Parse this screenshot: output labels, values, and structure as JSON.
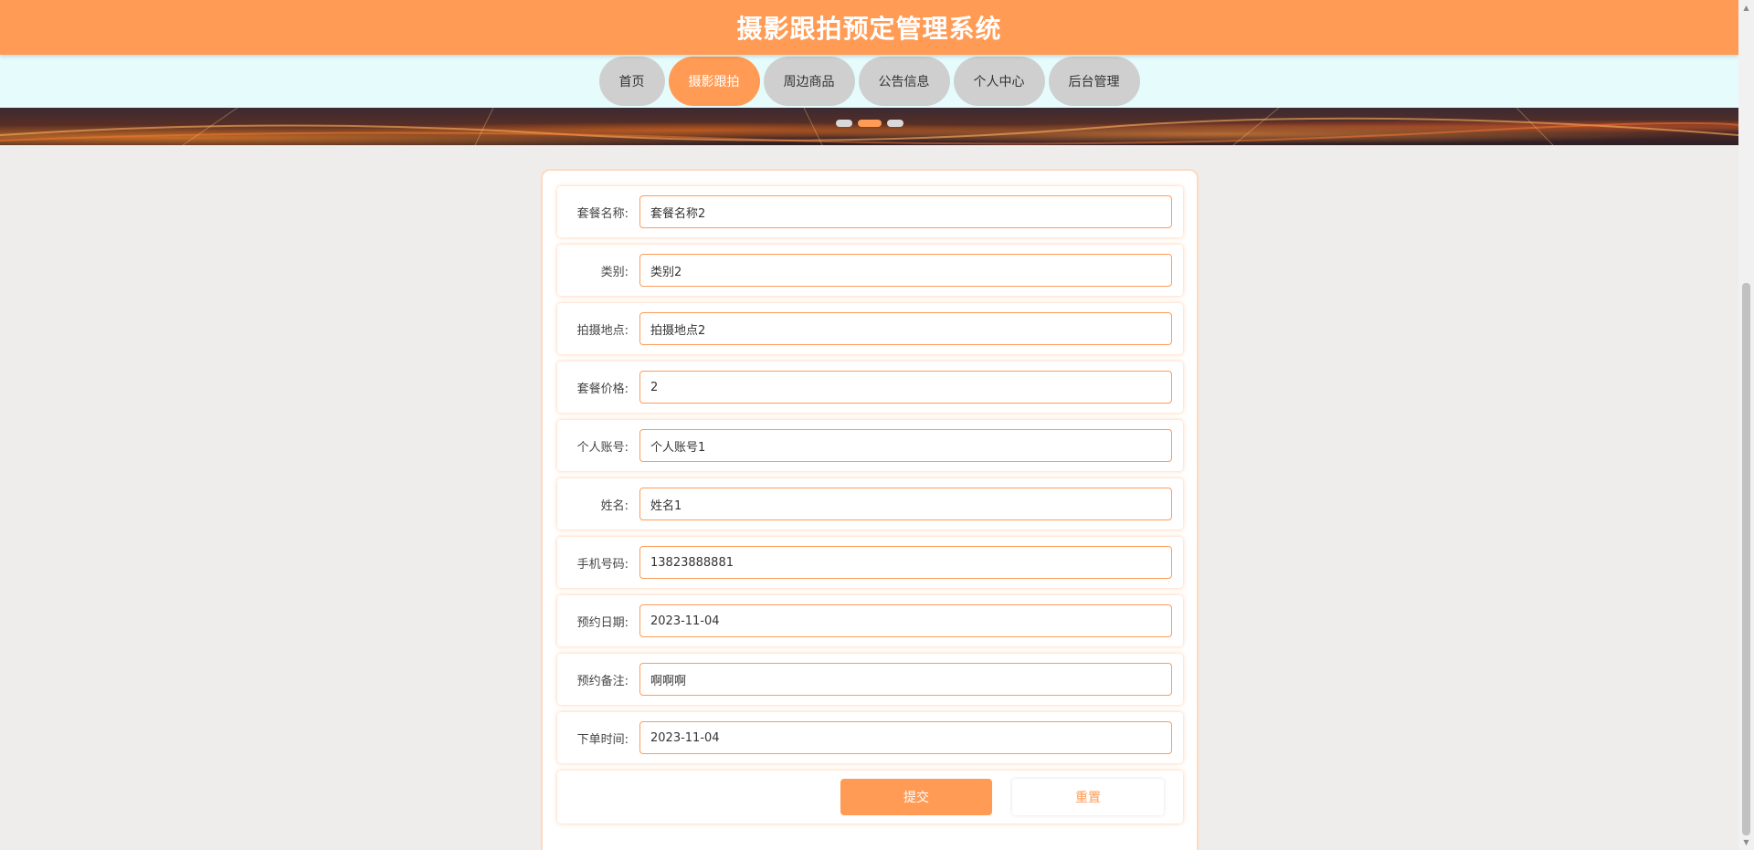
{
  "header": {
    "title": "摄影跟拍预定管理系统"
  },
  "nav": {
    "items": [
      {
        "label": "首页",
        "active": false
      },
      {
        "label": "摄影跟拍",
        "active": true
      },
      {
        "label": "周边商品",
        "active": false
      },
      {
        "label": "公告信息",
        "active": false
      },
      {
        "label": "个人中心",
        "active": false
      },
      {
        "label": "后台管理",
        "active": false
      }
    ]
  },
  "carousel": {
    "slide_count": 3,
    "active_index": 1
  },
  "form": {
    "fields": [
      {
        "label": "套餐名称:",
        "value": "套餐名称2"
      },
      {
        "label": "类别:",
        "value": "类别2"
      },
      {
        "label": "拍摄地点:",
        "value": "拍摄地点2"
      },
      {
        "label": "套餐价格:",
        "value": "2"
      },
      {
        "label": "个人账号:",
        "value": "个人账号1"
      },
      {
        "label": "姓名:",
        "value": "姓名1"
      },
      {
        "label": "手机号码:",
        "value": "13823888881"
      },
      {
        "label": "预约日期:",
        "value": "2023-11-04"
      },
      {
        "label": "预约备注:",
        "value": "啊啊啊"
      },
      {
        "label": "下单时间:",
        "value": "2023-11-04"
      }
    ],
    "submit_label": "提交",
    "reset_label": "重置"
  },
  "colors": {
    "accent": "#ff9b55",
    "nav_bg": "#e6fcfc",
    "nav_item": "#cfcfcf"
  }
}
